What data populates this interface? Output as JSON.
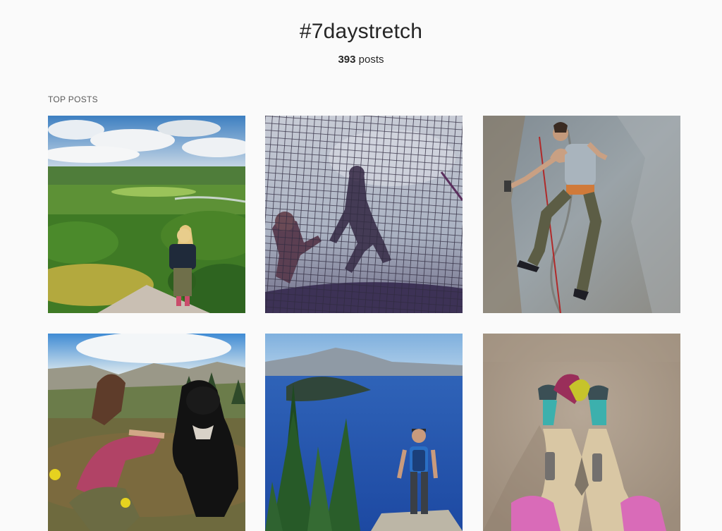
{
  "hashtag_page": {
    "title": "#7daystretch",
    "post_count": "393",
    "post_count_suffix": " posts",
    "section_label": "TOP POSTS"
  },
  "posts": [
    {
      "subject": "hiker-overlooking-valley"
    },
    {
      "subject": "people-on-climbing-net"
    },
    {
      "subject": "rock-climber-on-wall"
    },
    {
      "subject": "woman-with-black-dog"
    },
    {
      "subject": "hiker-at-crater-lake"
    },
    {
      "subject": "climbing-shoes-on-feet"
    }
  ],
  "colors": {
    "background": "#fafafa",
    "text": "#262626",
    "label": "#595959"
  }
}
